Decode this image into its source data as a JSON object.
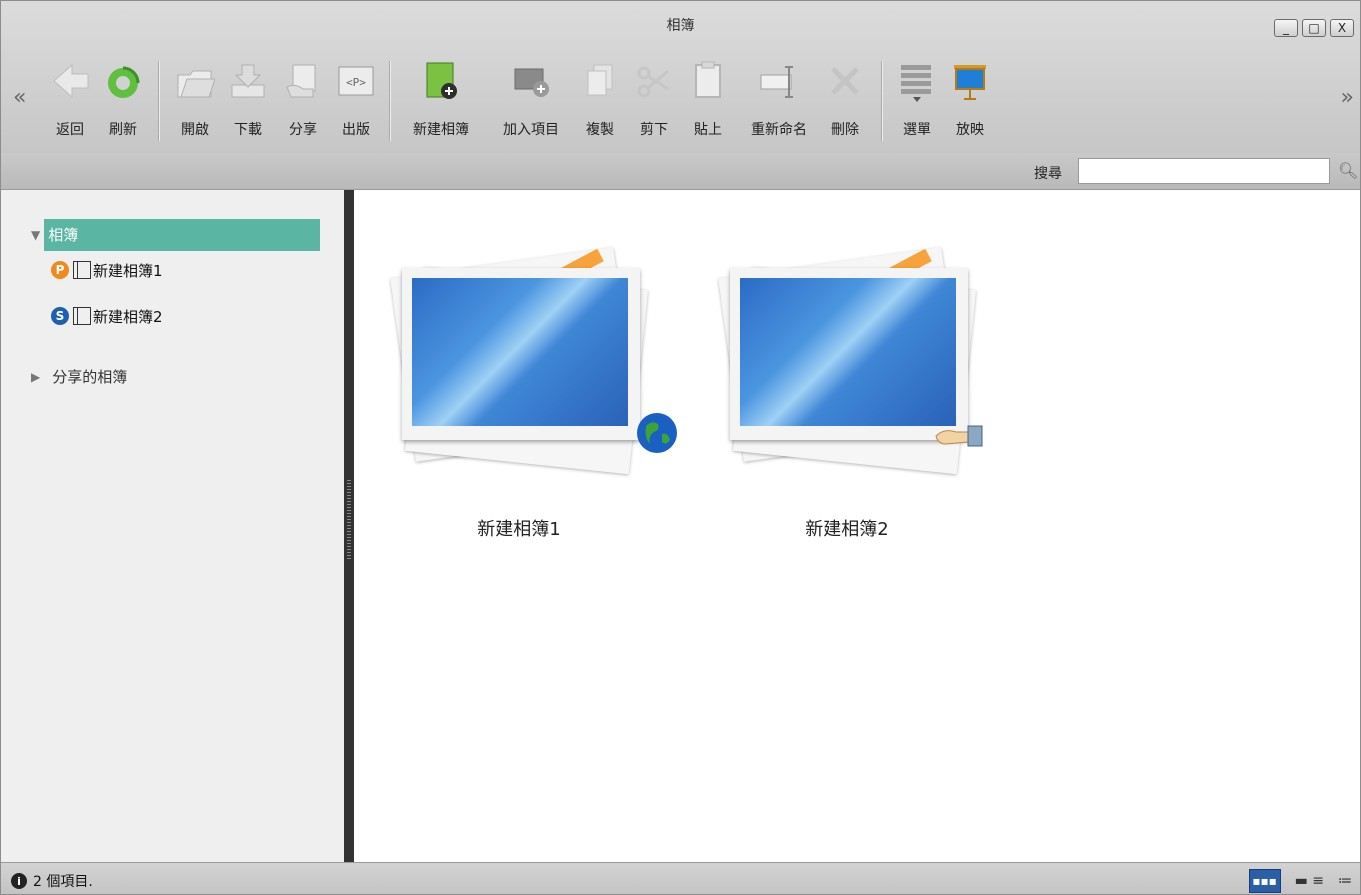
{
  "window": {
    "title": "相簿",
    "controls": {
      "minimize": "_",
      "maximize": "□",
      "close": "X"
    }
  },
  "toolbar": {
    "scroll_left": "«",
    "scroll_right": "»",
    "buttons": [
      {
        "label": "返回",
        "icon": "back-arrow-icon"
      },
      {
        "label": "刷新",
        "icon": "refresh-icon"
      },
      {
        "label": "開啟",
        "icon": "open-folder-icon"
      },
      {
        "label": "下載",
        "icon": "download-icon"
      },
      {
        "label": "分享",
        "icon": "share-icon"
      },
      {
        "label": "出版",
        "icon": "publish-icon"
      },
      {
        "label": "新建相簿",
        "icon": "new-album-icon"
      },
      {
        "label": "加入項目",
        "icon": "add-item-icon"
      },
      {
        "label": "複製",
        "icon": "copy-icon"
      },
      {
        "label": "剪下",
        "icon": "cut-icon"
      },
      {
        "label": "貼上",
        "icon": "paste-icon"
      },
      {
        "label": "重新命名",
        "icon": "rename-icon"
      },
      {
        "label": "刪除",
        "icon": "delete-icon"
      },
      {
        "label": "選單",
        "icon": "menu-icon"
      },
      {
        "label": "放映",
        "icon": "slideshow-icon"
      }
    ]
  },
  "search": {
    "label": "搜尋",
    "value": ""
  },
  "sidebar": {
    "root": {
      "label": "相簿",
      "expanded": true
    },
    "items": [
      {
        "badge": "P",
        "badge_color": "#f08a1c",
        "label": "新建相簿1"
      },
      {
        "badge": "S",
        "badge_color": "#1f5fb0",
        "label": "新建相簿2"
      }
    ],
    "shared": {
      "label": "分享的相簿",
      "expanded": false
    }
  },
  "albums": [
    {
      "name": "新建相簿1",
      "overlay": "globe-icon"
    },
    {
      "name": "新建相簿2",
      "overlay": "hand-share-icon"
    }
  ],
  "status": {
    "text": "2 個項目.",
    "views": [
      "grid-view-icon",
      "detail-view-icon",
      "list-view-icon"
    ]
  },
  "colors": {
    "selection": "#5ab5a2",
    "accent": "#2a5fa8"
  }
}
